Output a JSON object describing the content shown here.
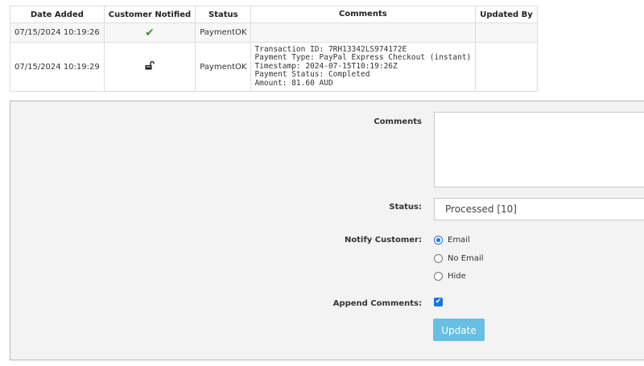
{
  "history": {
    "headers": {
      "date_added": "Date Added",
      "customer_notified": "Customer Notified",
      "status": "Status",
      "comments": "Comments",
      "updated_by": "Updated By"
    },
    "rows": [
      {
        "date_added": "07/15/2024 10:19:26",
        "customer_notified_icon": "check-icon",
        "status": "PaymentOK",
        "comments": [],
        "updated_by": ""
      },
      {
        "date_added": "07/15/2024 10:19:29",
        "customer_notified_icon": "unlocked-icon",
        "status": "PaymentOK",
        "comments": [
          "Transaction ID: 7RH13342LS974172E",
          "Payment Type: PayPal Express Checkout (instant)",
          "Timestamp: 2024-07-15T10:19:26Z",
          "Payment Status: Completed",
          "Amount: 81.60 AUD"
        ],
        "updated_by": ""
      }
    ]
  },
  "form": {
    "comments_label": "Comments",
    "comments_value": "",
    "status_label": "Status:",
    "status_value": "Processed [10]",
    "notify_label": "Notify Customer:",
    "notify_options": [
      "Email",
      "No Email",
      "Hide"
    ],
    "notify_selected": "Email",
    "append_label": "Append Comments:",
    "append_checked": true,
    "update_button": "Update"
  },
  "colors": {
    "accent": "#1a73e8",
    "button": "#67bfe3",
    "check": "#3a9a2a",
    "panel_bg": "#f3f3f3"
  }
}
